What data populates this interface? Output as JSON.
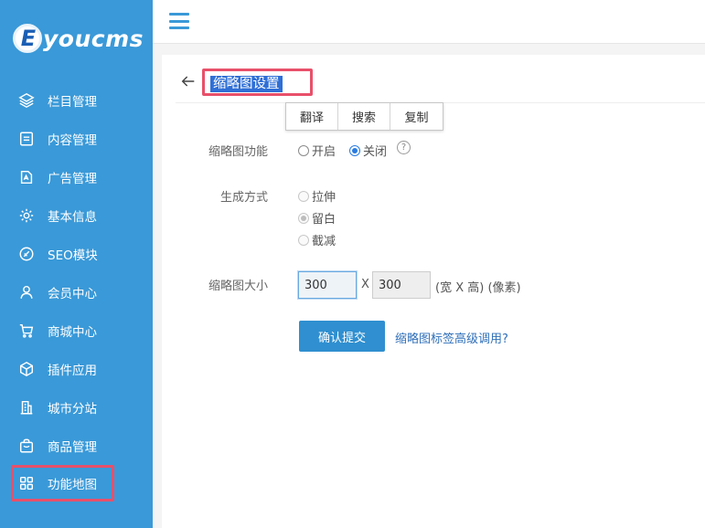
{
  "app": {
    "logo_letter": "E",
    "logo_text": "youcms"
  },
  "sidebar": {
    "items": [
      {
        "label": "栏目管理",
        "icon": "layers-icon"
      },
      {
        "label": "内容管理",
        "icon": "document-icon"
      },
      {
        "label": "广告管理",
        "icon": "ad-icon"
      },
      {
        "label": "基本信息",
        "icon": "gear-icon"
      },
      {
        "label": "SEO模块",
        "icon": "seo-icon"
      },
      {
        "label": "会员中心",
        "icon": "user-icon"
      },
      {
        "label": "商城中心",
        "icon": "cart-icon"
      },
      {
        "label": "插件应用",
        "icon": "cube-icon"
      },
      {
        "label": "城市分站",
        "icon": "building-icon"
      },
      {
        "label": "商品管理",
        "icon": "bag-icon"
      },
      {
        "label": "功能地图",
        "icon": "grid-icon"
      }
    ]
  },
  "header": {
    "title": "缩略图设置"
  },
  "context_toolbar": {
    "translate": "翻译",
    "search": "搜索",
    "copy": "复制"
  },
  "form": {
    "thumb_function": {
      "label": "缩略图功能",
      "options": [
        "开启",
        "关闭"
      ],
      "selected": "关闭"
    },
    "generate_mode": {
      "label": "生成方式",
      "options": [
        "拉伸",
        "留白",
        "截减"
      ],
      "selected": "留白"
    },
    "size": {
      "label": "缩略图大小",
      "width": "300",
      "height": "300",
      "separator": "X",
      "hint": "(宽 X 高) (像素)"
    },
    "submit_label": "确认提交",
    "advanced_link": "缩略图标签高级调用?"
  },
  "colors": {
    "sidebar_bg": "#3a99d8",
    "highlight_border": "#e8506a",
    "primary_button": "#2f8fd0",
    "selection": "#2f6fd6"
  }
}
